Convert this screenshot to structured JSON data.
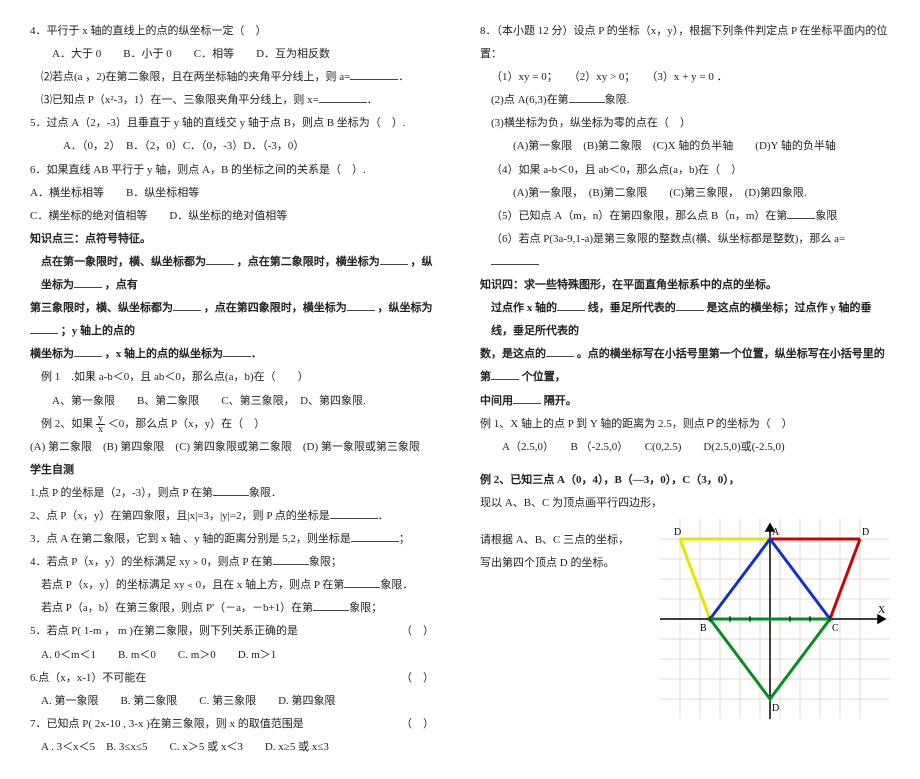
{
  "left": {
    "l4": "4．平行于 x 轴的直线上的点的纵坐标一定（　）",
    "l4opts": "A．大于 0　　B．小于 0　　C．相等　　D．互为相反数",
    "l4b": "⑵若点(a ，2)在第二象限，且在两坐标轴的夹角平分线上，则 a=",
    "l4c": "⑶已知点 P（x²-3，1）在一、三象限夹角平分线上，则 x=",
    "l5": "5．过点 A（2，-3）且垂直于 y 轴的直线交 y 轴于点 B，则点 B 坐标为（　）.",
    "l5opts": "A．（0，2）　B．（2，0）C．（0，-3）D．（-3，0）",
    "l6": "6．如果直线 AB 平行于 y 轴，则点 A，B 的坐标之间的关系是（　）.",
    "l6a": "A．横坐标相等　　B．纵坐标相等",
    "l6b": "C．横坐标的绝对值相等　　D．纵坐标的绝对值相等",
    "k3title": "知识点三：点符号特征。",
    "k3a": "点在第一象限时，横、纵坐标都为",
    "k3b": "，点在第二象限时，横坐标为",
    "k3c": "，纵坐标为",
    "k3d": "，点有",
    "k3e": "第三象限时，横、纵坐标都为",
    "k3f": "，点在第四象限时，横坐标为",
    "k3g": "，纵坐标为",
    "k3h": "；y 轴上的点的",
    "k3i": "横坐标为",
    "k3j": "，x 轴上的点的纵坐标为",
    "eg1": "例 1　.如果 a-b＜0，且 ab＜0，那么点(a，b)在（　　）",
    "eg1opts": "A、第一象限　　B、第二象限　　C、第三象限，　D、第四象限.",
    "eg2a": "例 2、如果",
    "eg2b": "＜0，那么点 P（x，y）在（　）",
    "eg2opts": "(A) 第二象限　(B) 第四象限　(C) 第四象限或第二象限　(D) 第一象限或第三象限",
    "selftest": "学生自测",
    "s1": "1.点 P 的坐标是（2，-3），则点 P 在第",
    "s1b": "象限．",
    "s2": "2、点 P（x，y）在第四象限，且|x|=3，|y|=2，则 P 点的坐标是",
    "s3": "3．点 A 在第二象限，它到 x 轴 、y 轴的距离分别是 5,2，则坐标是",
    "s4": "4．若点 P（x，y）的坐标满足 xy﹥0，则点 P 在第",
    "s4b": "象限；",
    "s4c": "若点 P（x，y）的坐标满足 xy﹤0，且在 x 轴上方，则点 P 在第",
    "s4d": "象限．",
    "s4e": "若点 P（a，b）在第三象限，则点 P'（－a，－b+1）在第",
    "s4f": "象限；",
    "s5": "5．若点 P( 1-m ， m )在第二象限，则下列关系正确的是",
    "s5opts": "A. 0＜m＜1　　B. m＜0　　C. m＞0　　D. m＞1",
    "s6": "6.点（x，x-1）不可能在",
    "s6opts": "A. 第一象限　　B. 第二象限　　C. 第三象限　　D. 第四象限",
    "s7": "7．已知点 P( 2x-10 , 3-x )在第三象限，则 x 的取值范围是",
    "s7opts": "A . 3＜x＜5　B. 3≤x≤5　　C. x＞5 或 x＜3　　D. x≥5 或 x≤3"
  },
  "right": {
    "r8": "8．（本小题 12 分）设点 P 的坐标（x，y），根据下列条件判定点 P 在坐标平面内的位置：",
    "r8a": "（1）xy = 0；　　（2）xy > 0；　　（3）x + y = 0 ．",
    "r8b": "(2)点 A(6,3)在第",
    "r8bb": "象限.",
    "r8c": "(3)横坐标为负，纵坐标为零的点在（　）",
    "r8copts": "(A)第一象限　(B)第二象限　(C)X 轴的负半轴　　(D)Y 轴的负半轴",
    "r8d": "（4）如果 a-b＜0，且 ab＜0，那么点(a，b)在（　）",
    "r8dopts": "(A)第一象限，　(B)第二象限　　(C)第三象限，　(D)第四象限.",
    "r8e": "（5）已知点 A（m，n）在第四象限，那么点 B（n，m）在第",
    "r8eb": "象限",
    "r8f": "（6）若点 P(3a-9,1-a)是第三象限的整数点(横、纵坐标都是整数)，那么 a=",
    "k4title": "知识四：求一些特殊图形，在平面直角坐标系中的点的坐标。",
    "k4a": "过点作 x 轴的",
    "k4b": "线，垂足所代表的",
    "k4c": "是这点的横坐标；过点作 y 轴的垂线，垂足所代表的",
    "k4d": "数，是这点的",
    "k4e": "。点的横坐标写在小括号里第一个位置，纵坐标写在小括号里的第",
    "k4f": "个位置，",
    "k4g": "中间用",
    "k4h": "隔开。",
    "reg1": "例 1、X 轴上的点 P 到 Y 轴的距离为 2.5，则点Ｐ的坐标为（　）",
    "reg1opts": "A（2.5,0）　　B （-2.5,0）　　C(0,2.5)　　D(2.5,0)或(-2.5,0)",
    "reg2": "例 2、已知三点 A（0，4），B（—3，0），C（3，0），",
    "reg2b": "现以 A、B、C 为顶点画平行四边形，",
    "reg2c": "请根据 A、B、C 三点的坐标，",
    "reg2d": "写出第四个顶点 D 的坐标。",
    "diag": {
      "labels": [
        "D",
        "A",
        "D",
        "B",
        "C",
        "D",
        "X"
      ]
    }
  }
}
